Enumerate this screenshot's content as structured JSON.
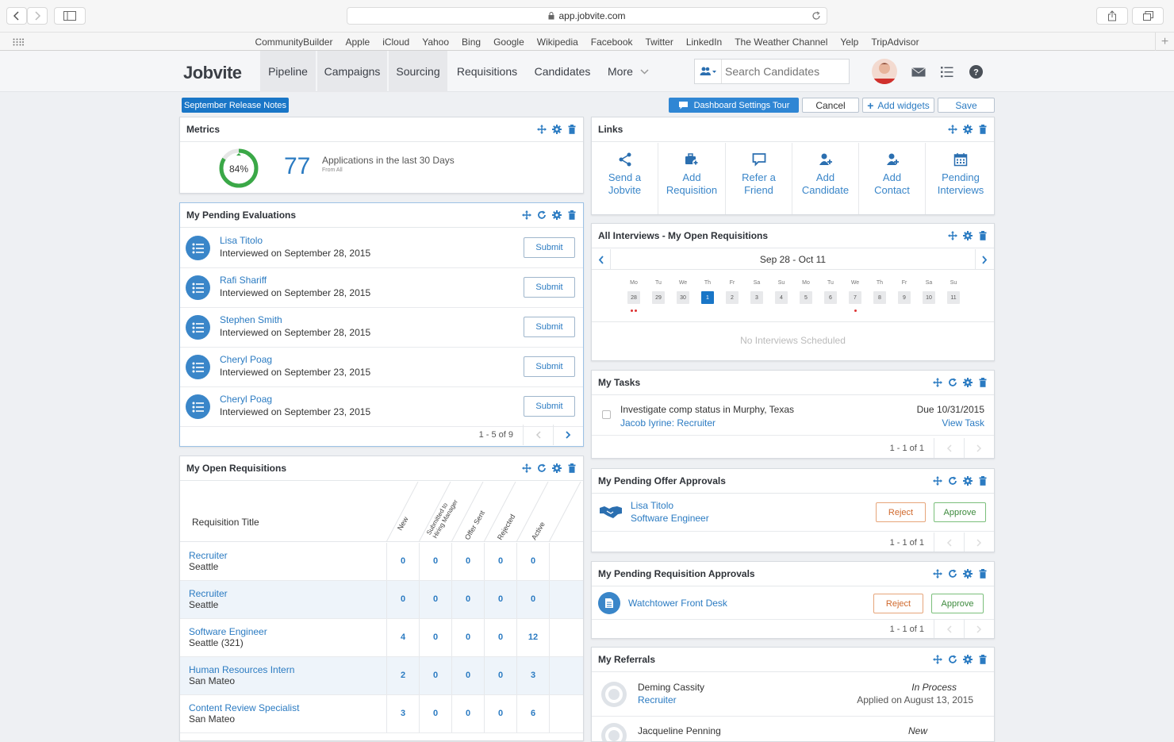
{
  "browser": {
    "url": "app.jobvite.com",
    "bookmarks": [
      "CommunityBuilder",
      "Apple",
      "iCloud",
      "Yahoo",
      "Bing",
      "Google",
      "Wikipedia",
      "Facebook",
      "Twitter",
      "LinkedIn",
      "The Weather Channel",
      "Yelp",
      "TripAdvisor"
    ]
  },
  "header": {
    "logo": "Jobvite",
    "nav": [
      "Pipeline",
      "Campaigns",
      "Sourcing",
      "Requisitions",
      "Candidates",
      "More"
    ],
    "search_placeholder": "Search Candidates"
  },
  "toolbar": {
    "release_notes": "September Release Notes",
    "tour": "Dashboard Settings Tour",
    "cancel": "Cancel",
    "add_widgets": "Add widgets",
    "save": "Save"
  },
  "metrics": {
    "title": "Metrics",
    "percent": "84%",
    "percent_value": 0.84,
    "count": "77",
    "label": "Applications in the last 30 Days",
    "sublabel": "From All"
  },
  "evaluations": {
    "title": "My Pending Evaluations",
    "submit_label": "Submit",
    "items": [
      {
        "name": "Lisa Titolo",
        "detail": "Interviewed on September 28, 2015"
      },
      {
        "name": "Rafi Shariff",
        "detail": "Interviewed on September 28, 2015"
      },
      {
        "name": "Stephen Smith",
        "detail": "Interviewed on September 28, 2015"
      },
      {
        "name": "Cheryl Poag",
        "detail": "Interviewed on September 23, 2015"
      },
      {
        "name": "Cheryl Poag",
        "detail": "Interviewed on September 23, 2015"
      }
    ],
    "pager": "1 - 5 of 9"
  },
  "requisitions": {
    "title": "My Open Requisitions",
    "col_title": "Requisition Title",
    "columns": [
      "New",
      "Submitted to Hiring Manager",
      "Offer Sent",
      "Rejected",
      "Active"
    ],
    "rows": [
      {
        "title": "Recruiter",
        "location": "Seattle",
        "values": [
          "0",
          "0",
          "0",
          "0",
          "0"
        ]
      },
      {
        "title": "Recruiter",
        "location": "Seattle",
        "values": [
          "0",
          "0",
          "0",
          "0",
          "0"
        ]
      },
      {
        "title": "Software Engineer",
        "location": "Seattle (321)",
        "values": [
          "4",
          "0",
          "0",
          "0",
          "12"
        ]
      },
      {
        "title": "Human Resources Intern",
        "location": "San Mateo",
        "values": [
          "2",
          "0",
          "0",
          "0",
          "3"
        ]
      },
      {
        "title": "Content Review Specialist",
        "location": "San Mateo",
        "values": [
          "3",
          "0",
          "0",
          "0",
          "6"
        ]
      }
    ]
  },
  "links": {
    "title": "Links",
    "items": [
      {
        "line1": "Send a",
        "line2": "Jobvite",
        "icon": "share-icon"
      },
      {
        "line1": "Add",
        "line2": "Requisition",
        "icon": "briefcase-plus-icon"
      },
      {
        "line1": "Refer a",
        "line2": "Friend",
        "icon": "chat-icon"
      },
      {
        "line1": "Add",
        "line2": "Candidate",
        "icon": "user-plus-icon"
      },
      {
        "line1": "Add",
        "line2": "Contact",
        "icon": "contact-plus-icon"
      },
      {
        "line1": "Pending",
        "line2": "Interviews",
        "icon": "calendar-icon"
      }
    ]
  },
  "interviews": {
    "title": "All Interviews - My Open Requisitions",
    "range": "Sep 28 - Oct 11",
    "weekdays": [
      "Mo",
      "Tu",
      "We",
      "Th",
      "Fr",
      "Sa",
      "Su",
      "Mo",
      "Tu",
      "We",
      "Th",
      "Fr",
      "Sa",
      "Su"
    ],
    "days": [
      "28",
      "29",
      "30",
      "1",
      "2",
      "3",
      "4",
      "5",
      "6",
      "7",
      "8",
      "9",
      "10",
      "11"
    ],
    "selected_index": 3,
    "dots": [
      {
        "index": 0,
        "count": 2
      },
      {
        "index": 9,
        "count": 1
      }
    ],
    "empty": "No Interviews Scheduled"
  },
  "tasks": {
    "title": "My Tasks",
    "task": "Investigate comp status in Murphy, Texas",
    "assignee": "Jacob Iyrine: Recruiter",
    "due": "Due 10/31/2015",
    "view": "View Task",
    "pager": "1 - 1 of 1"
  },
  "offers": {
    "title": "My Pending Offer Approvals",
    "name": "Lisa Titolo",
    "role": "Software Engineer",
    "reject": "Reject",
    "approve": "Approve",
    "pager": "1 - 1 of 1"
  },
  "req_approvals": {
    "title": "My Pending Requisition Approvals",
    "name": "Watchtower Front Desk",
    "reject": "Reject",
    "approve": "Approve",
    "pager": "1 - 1 of 1"
  },
  "referrals": {
    "title": "My Referrals",
    "items": [
      {
        "name": "Deming Cassity",
        "role": "Recruiter",
        "status": "In Process",
        "applied": "Applied on August 13, 2015"
      },
      {
        "name": "Jacqueline Penning",
        "role": "",
        "status": "New",
        "applied": ""
      }
    ]
  },
  "colors": {
    "accent": "#1976c7",
    "link": "#2b7bc2",
    "donut": "#3aa847",
    "reject": "#d0692d",
    "approve": "#3d8a3d"
  }
}
